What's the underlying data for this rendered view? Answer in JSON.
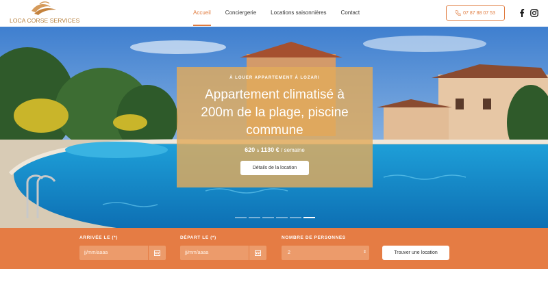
{
  "brand": {
    "name": "LOCA CORSE SERVICES",
    "accent": "#e07b3e"
  },
  "nav": {
    "items": [
      {
        "label": "Accueil",
        "active": true
      },
      {
        "label": "Conciergerie",
        "active": false
      },
      {
        "label": "Locations saisonnières",
        "active": false
      },
      {
        "label": "Contact",
        "active": false
      }
    ]
  },
  "header": {
    "phone": "07 87 88 07 53",
    "phone_icon": "phone-icon",
    "social": [
      "facebook-icon",
      "instagram-icon"
    ]
  },
  "hero": {
    "kicker": "À LOUER APPARTEMENT À LOZARI",
    "title": "Appartement climatisé à 200m de la plage, piscine commune",
    "price_from": "620",
    "price_sep": "à",
    "price_to": "1130 €",
    "price_unit": "/ semaine",
    "details_label": "Détails de la location",
    "slides": 6,
    "active_slide": 6
  },
  "search": {
    "arrival_label": "ARRIVÉE LE (*)",
    "arrival_placeholder": "jj/mm/aaaa",
    "departure_label": "DÉPART LE (*)",
    "departure_placeholder": "jj/mm/aaaa",
    "people_label": "NOMBRE DE PERSONNES",
    "people_value": "2",
    "submit_label": "Trouver une location",
    "calendar_icon": "calendar-icon"
  }
}
